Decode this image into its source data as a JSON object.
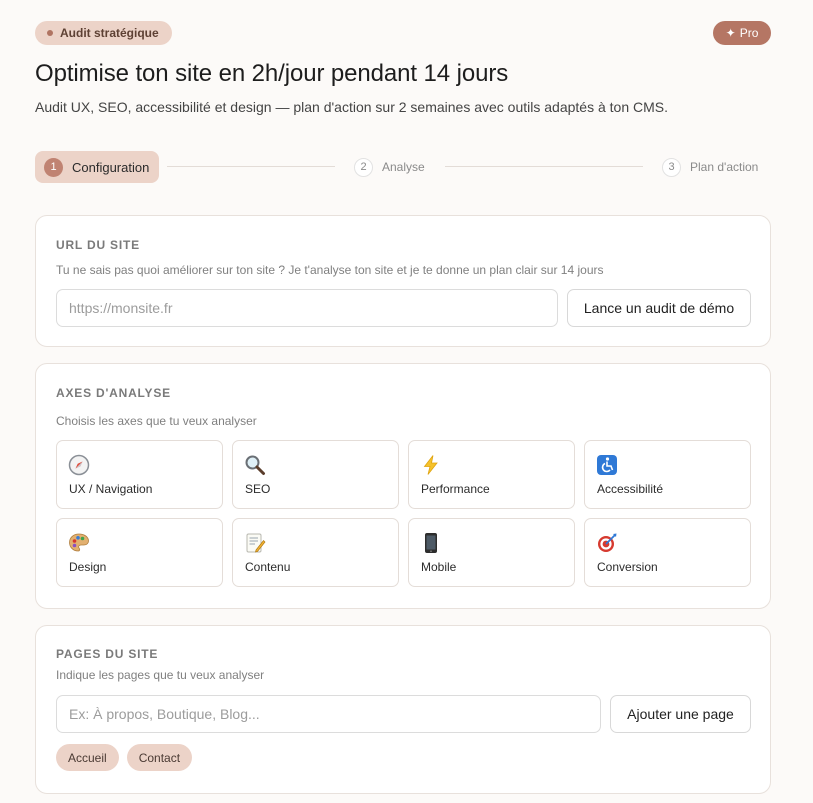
{
  "header": {
    "badge": "Audit stratégique",
    "pro_label": "Pro",
    "title": "Optimise ton site en 2h/jour pendant 14 jours",
    "subtitle": "Audit UX, SEO, accessibilité et design — plan d'action sur 2 semaines avec outils adaptés à ton CMS."
  },
  "stepper": {
    "steps": [
      {
        "num": "1",
        "label": "Configuration",
        "active": true
      },
      {
        "num": "2",
        "label": "Analyse",
        "active": false
      },
      {
        "num": "3",
        "label": "Plan d'action",
        "active": false
      }
    ]
  },
  "url_section": {
    "title": "URL DU SITE",
    "description": "Tu ne sais pas quoi améliorer sur ton site ? Je t'analyse ton site et je te donne un plan clair sur 14 jours",
    "input_placeholder": "https://monsite.fr",
    "input_value": "",
    "demo_button": "Lance un audit de démo"
  },
  "axes_section": {
    "title": "AXES D'ANALYSE",
    "description": "Choisis les axes que tu veux analyser",
    "axes": [
      {
        "label": "UX / Navigation",
        "icon": "compass-icon"
      },
      {
        "label": "SEO",
        "icon": "magnifier-icon"
      },
      {
        "label": "Performance",
        "icon": "lightning-icon"
      },
      {
        "label": "Accessibilité",
        "icon": "wheelchair-icon"
      },
      {
        "label": "Design",
        "icon": "palette-icon"
      },
      {
        "label": "Contenu",
        "icon": "memo-icon"
      },
      {
        "label": "Mobile",
        "icon": "mobile-phone-icon"
      },
      {
        "label": "Conversion",
        "icon": "target-icon"
      }
    ]
  },
  "pages_section": {
    "title": "PAGES DU SITE",
    "description": "Indique les pages que tu veux analyser",
    "input_placeholder": "Ex: À propos, Boutique, Blog...",
    "add_button": "Ajouter une page",
    "pages": [
      "Accueil",
      "Contact"
    ]
  },
  "colors": {
    "accent": "#b57664",
    "accent_light": "#ecd3c8",
    "background": "#fcfaf8"
  }
}
